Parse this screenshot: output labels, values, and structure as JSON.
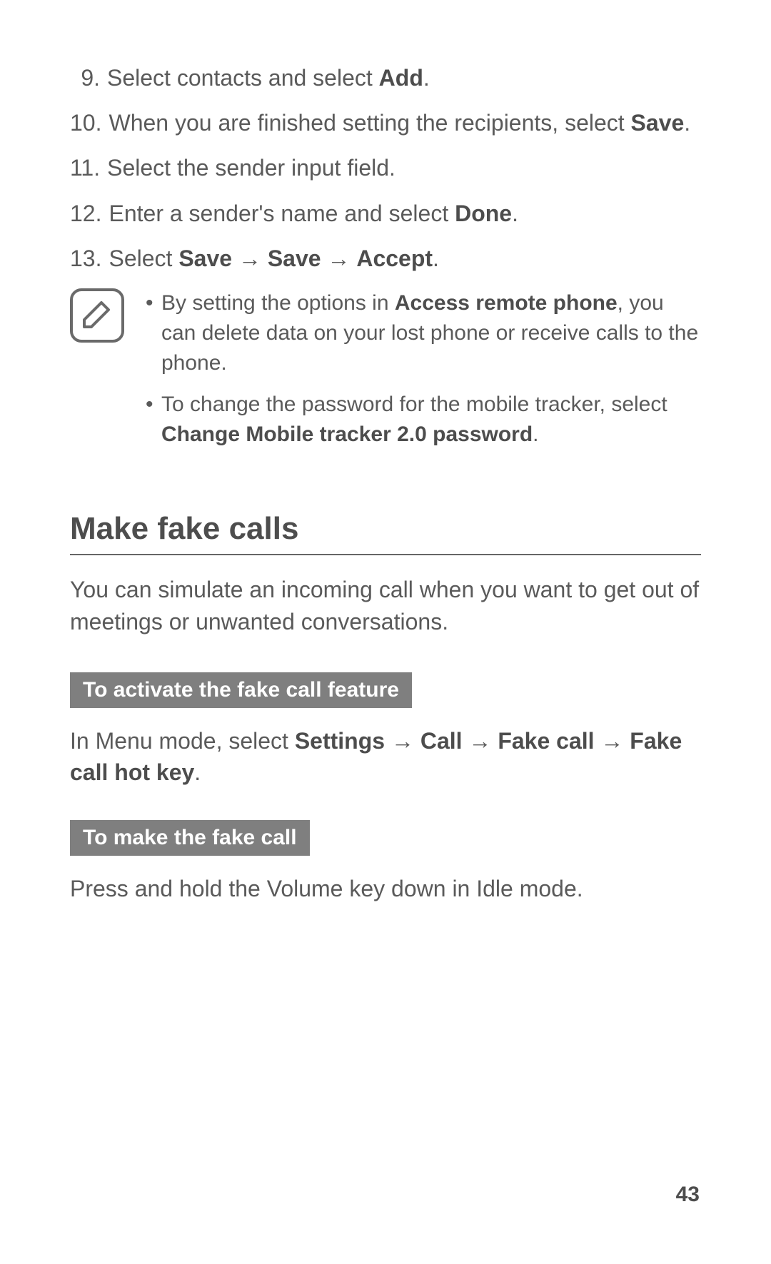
{
  "steps": [
    {
      "n": "9.",
      "pre": "Select contacts and select ",
      "bold1": "Add",
      "post": "."
    },
    {
      "n": "10.",
      "pre": "When you are finished setting the recipients, select ",
      "bold1": "Save",
      "post": "."
    },
    {
      "n": "11.",
      "pre": "Select the sender input field.",
      "bold1": "",
      "post": ""
    },
    {
      "n": "12.",
      "pre": "Enter a sender's name and select ",
      "bold1": "Done",
      "post": "."
    }
  ],
  "step13": {
    "n": "13.",
    "pre": "Select ",
    "b1": "Save",
    "arrow1": " → ",
    "b2": "Save",
    "arrow2": " → ",
    "b3": "Accept",
    "post": "."
  },
  "note": {
    "icon": "pencil-note-icon",
    "bullets": [
      {
        "pre": "By setting the options in ",
        "b1": "Access remote phone",
        "mid": ", you can delete data on your lost phone or receive calls to the phone.",
        "b2": "",
        "post": ""
      },
      {
        "pre": "To change the password for the mobile tracker, select ",
        "b1": "Change Mobile tracker 2.0 password",
        "mid": ".",
        "b2": "",
        "post": ""
      }
    ],
    "dot": "•"
  },
  "section": {
    "heading": "Make fake calls",
    "intro": "You can simulate an incoming call when you want to get out of meetings or unwanted conversations.",
    "sub1_title": "To activate the fake call feature",
    "sub1_text": {
      "pre": "In Menu mode, select ",
      "b1": "Settings",
      "a1": " → ",
      "b2": "Call",
      "a2": " → ",
      "b3": "Fake call",
      "a3": " → ",
      "b4": "Fake call hot key",
      "post": "."
    },
    "sub2_title": "To make the fake call",
    "sub2_text": "Press and hold the Volume key down in Idle mode."
  },
  "page_number": "43"
}
